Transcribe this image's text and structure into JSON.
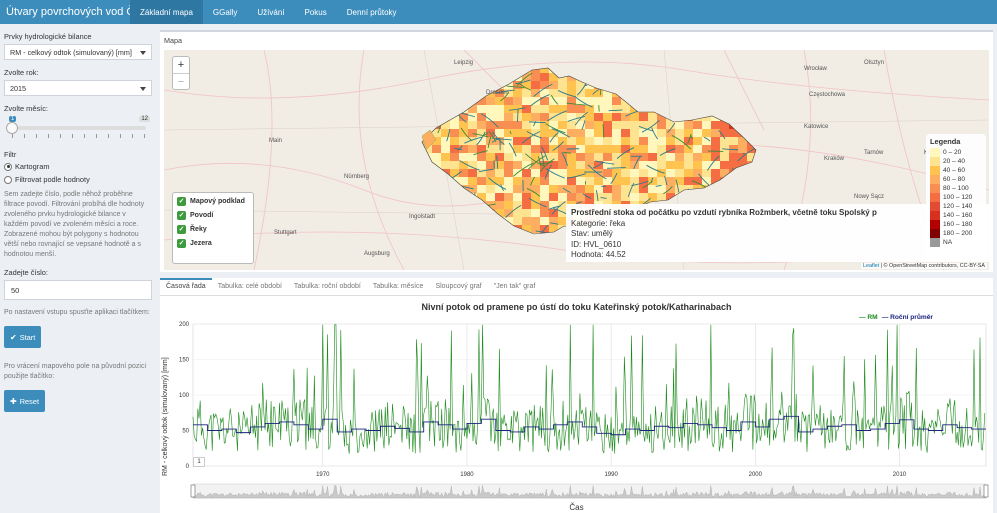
{
  "app": {
    "title": "Útvary povrchových vod ČR",
    "nav_tabs": [
      "Základní mapa",
      "GGally",
      "Užívání",
      "Pokus",
      "Denní průtoky"
    ],
    "active_tab": 0
  },
  "sidebar": {
    "prvky_label": "Prvky hydrologické bilance",
    "prvky_value": "RM - celkový odtok (simulovaný) [mm]",
    "rok_label": "Zvolte rok:",
    "rok_value": "2015",
    "mesic_label": "Zvolte měsíc:",
    "mesic_min": "1",
    "mesic_max": "12",
    "mesic_value": 1,
    "filtr_label": "Filtr",
    "radio_kartogram": "Kartogram",
    "radio_filtrovat": "Filtrovat podle hodnoty",
    "help_text": "Sem zadejte číslo, podle něhož proběhne filtrace povodí. Filtrování probíhá dle hodnoty zvoleného prvku hydrologické bilance v každém povodí ve zvoleném měsíci a roce. Zobrazené mohou být polygony s hodnotou větší nebo rovnající se vepsané hodnotě a s hodnotou menší.",
    "cislo_label": "Zadejte číslo:",
    "cislo_value": "50",
    "start_help": "Po nastavení vstupu spusťte aplikaci tlačítkem:",
    "start_label": "Start",
    "reset_help": "Pro vrácení mapového pole na původní pozici použijte tlačítko:",
    "reset_label": "Reset"
  },
  "map": {
    "box_title": "Mapa",
    "zoom_in": "+",
    "zoom_out": "−",
    "layers": [
      "Mapový podklad",
      "Povodí",
      "Řeky",
      "Jezera"
    ],
    "legend_title": "Legenda",
    "legend": [
      {
        "label": "0 – 20",
        "color": "#fff7bc"
      },
      {
        "label": "20 – 40",
        "color": "#fee391"
      },
      {
        "label": "40 – 60",
        "color": "#fec44f"
      },
      {
        "label": "60 – 80",
        "color": "#fdae61"
      },
      {
        "label": "80 – 100",
        "color": "#f98e52"
      },
      {
        "label": "100 – 120",
        "color": "#f46d43"
      },
      {
        "label": "120 – 140",
        "color": "#e34a33"
      },
      {
        "label": "140 – 160",
        "color": "#d7301f"
      },
      {
        "label": "160 – 180",
        "color": "#b30000"
      },
      {
        "label": "180 – 200",
        "color": "#7f0000"
      },
      {
        "label": "NA",
        "color": "#999999"
      }
    ],
    "cities": [
      "Leipzig",
      "Dresden",
      "Wrocław",
      "Katowice",
      "Kraków",
      "Main",
      "Nürnberg",
      "Stuttgart",
      "Ingolstadt",
      "Augsburg",
      "Olsztyn",
      "Częstochowa",
      "Nowy Sącz",
      "Tarnów",
      "Krosno"
    ],
    "tooltip": {
      "title": "Prostřední stoka od počátku po vzdutí rybníka Rožmberk, včetně toku Spolský p",
      "kategorie": "Kategorie: řeka",
      "stav": "Stav: umělý",
      "id": "ID: HVL_0610",
      "hodnota": "Hodnota: 44.52"
    },
    "attribution_leaflet": "Leaflet",
    "attribution_text": "| © OpenStreetMap contributors, CC-BY-SA"
  },
  "chart_tabs": [
    "Časová řada",
    "Tabulka: celé období",
    "Tabulka: roční období",
    "Tabulka: měsíce",
    "Sloupcový graf",
    "\"Jen tak\" graf"
  ],
  "chart_data": {
    "type": "line",
    "title": "Nivní potok od pramene po ústí do toku Kateřinský potok/Katharinabach",
    "xlabel": "Čas",
    "ylabel": "RM - celkový odtok (simulovaný) [mm]",
    "ylim": [
      0,
      200
    ],
    "yticks": [
      0,
      50,
      100,
      150,
      200
    ],
    "xticks": [
      "1970",
      "1980",
      "1990",
      "2000",
      "2010"
    ],
    "xlim": [
      1961,
      2016
    ],
    "series": [
      {
        "name": "RM",
        "color": "#1a8a1a"
      },
      {
        "name": "Roční průměr",
        "color": "#1a237e"
      }
    ],
    "annual_mean": [
      58,
      50,
      52,
      47,
      55,
      60,
      62,
      58,
      52,
      66,
      48,
      52,
      50,
      56,
      53,
      48,
      62,
      58,
      52,
      60,
      66,
      50,
      48,
      55,
      52,
      58,
      62,
      55,
      46,
      44,
      52,
      50,
      56,
      54,
      60,
      58,
      54,
      50,
      62,
      55,
      66,
      70,
      48,
      52,
      56,
      58,
      50,
      52,
      60,
      65,
      52,
      50,
      58,
      54,
      52
    ],
    "range_label": "1"
  }
}
